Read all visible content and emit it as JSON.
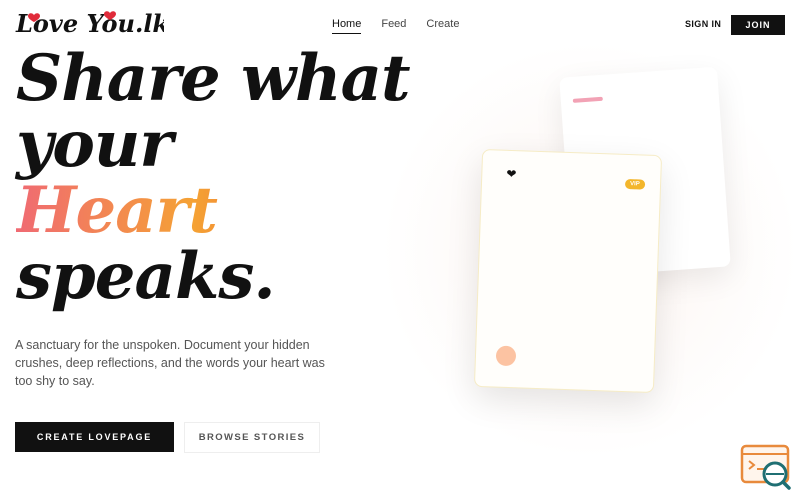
{
  "brand": {
    "logo_text": "Love You.lk"
  },
  "nav": {
    "items": [
      "Home",
      "Feed",
      "Create"
    ]
  },
  "header": {
    "signin_label": "SIGN IN",
    "join_label": "JOIN"
  },
  "hero": {
    "line1": "Share what",
    "line2": "your",
    "line3": "Heart",
    "line4": "speaks.",
    "subtitle": "A sanctuary for the unspoken. Document your hidden crushes, deep reflections, and the words your heart was too shy to say.",
    "primary_cta": "CREATE LOVEPAGE",
    "secondary_cta": "BROWSE STORIES"
  },
  "card": {
    "icon": "heart-icon",
    "badge": "VIP"
  },
  "colors": {
    "accent_dark": "#111111",
    "heart_gradient_start": "#f06a73",
    "heart_gradient_mid": "#f5a234",
    "heart_gradient_end": "#e8353f",
    "badge": "#f3b62b",
    "widget_orange": "#e88a3c",
    "widget_teal": "#1f6f73"
  },
  "widget": {
    "icon": "chat-search-icon"
  }
}
